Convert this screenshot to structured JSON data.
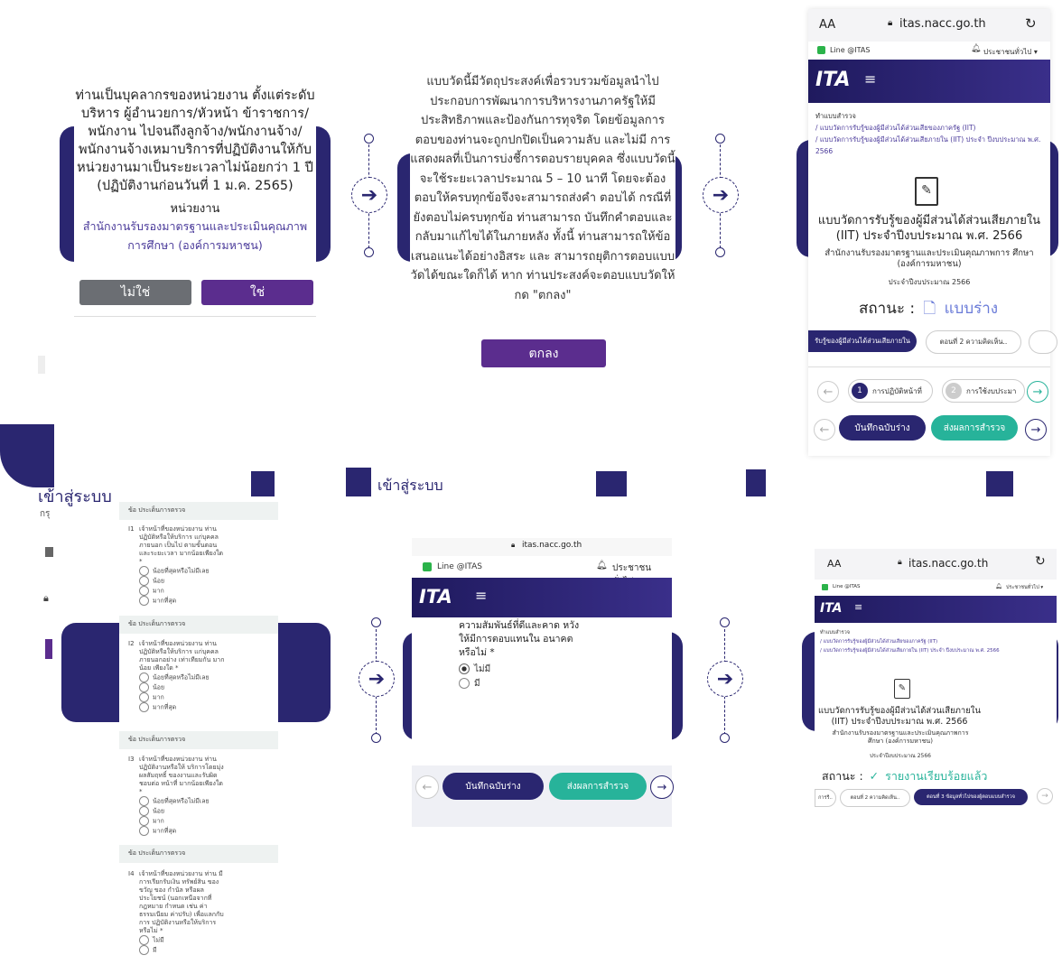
{
  "step1": {
    "question": "ท่านเป็นบุคลากรของหน่วยงาน ตั้งแต่ระดับ บริหาร ผู้อำนวยการ/หัวหน้า ข้าราชการ/ พนักงาน ไปจนถึงลูกจ้าง/พนักงานจ้าง/ พนักงานจ้างเหมาบริการที่ปฏิบัติงานให้กับ หน่วยงานมาเป็นระยะเวลาไม่น้อยกว่า 1 ปี (ปฏิบัติงานก่อนวันที่ 1 ม.ค. 2565)",
    "agency_label": "หน่วยงาน",
    "agency_name": "สำนักงานรับรองมาตรฐานและประเมินคุณภาพ การศึกษา (องค์การมหาชน)",
    "no_label": "ไม่ใช่",
    "yes_label": "ใช่"
  },
  "step2": {
    "text": "แบบวัดนี้มีวัตถุประสงค์เพื่อรวบรวมข้อมูลนำไป ประกอบการพัฒนาการบริหารงานภาครัฐให้มี ประสิทธิภาพและป้องกันการทุจริต โดยข้อมูลการ ตอบของท่านจะถูกปกปิดเป็นความลับ และไม่มี การแสดงผลที่เป็นการบ่งชี้การตอบรายบุคคล ซึ่งแบบวัดนี้จะใช้ระยะเวลาประมาณ 5 – 10 นาที โดยจะต้องตอบให้ครบทุกข้อจึงจะสามารถส่งคำ ตอบได้ กรณีที่ยังตอบไม่ครบทุกข้อ ท่านสามารถ บันทึกคำตอบและกลับมาแก้ไขได้ในภายหลัง ทั้งนี้ ท่านสามารถให้ข้อเสนอแนะได้อย่างอิสระ และ สามารถยุติการตอบแบบวัดได้ขณะใดก็ได้ หาก ท่านประสงค์จะตอบแบบวัดให้กด \"ตกลง\"",
    "ok_label": "ตกลง"
  },
  "step3": {
    "aa": "AA",
    "url": "itas.nacc.go.th",
    "line": "Line @ITAS",
    "public_menu": "ประชาชนทั่วไป ▾",
    "logo": "ITA",
    "breadcrumb": [
      "ทำแบบสำรวจ",
      "/ แบบวัดการรับรู้ของผู้มีส่วนได้ส่วนเสียของภาครัฐ (IIT)",
      "/ แบบวัดการรับรู้ของผู้มีส่วนได้ส่วนเสียภายใน (IIT) ประจำ ปีงบประมาณ พ.ศ. 2566"
    ],
    "title": "แบบวัดการรับรู้ของผู้มีส่วนได้ส่วนเสียภายใน (IIT) ประจำปีงบประมาณ พ.ศ. 2566",
    "org": "สำนักงานรับรองมาตรฐานและประเมินคุณภาพการ ศึกษา (องค์การมหาชน)",
    "fy": "ประจำปีงบประมาณ 2566",
    "status_label": "สถานะ :",
    "status_value": "แบบร่าง",
    "tab1": "รับรู้ของผู้มีส่วนได้ส่วนเสียภายใน",
    "tab2": "ตอนที่ 2 ความคิดเห็น..",
    "step_1": "การปฏิบัติหน้าที่",
    "step_2": "การใช้งบประมา",
    "save_draft": "บันทึกฉบับร่าง",
    "submit": "ส่งผลการสำรวจ"
  },
  "login": {
    "left": "เข้าสู่ระบบ",
    "mid": "เข้าสู่ระบบ",
    "hint": "กรุ"
  },
  "step4": {
    "sections": [
      {
        "header": "ข้อ ประเด็นการตรวจ",
        "num": "I1",
        "q": "เจ้าหน้าที่ของหน่วยงาน ท่าน ปฏิบัติหรือให้บริการ แก่บุคคลภายนอก เป็นไป ตามขั้นตอนและระยะเวลา มากน้อยเพียงใด *",
        "opts": [
          "น้อยที่สุดหรือไม่มีเลย",
          "น้อย",
          "มาก",
          "มากที่สุด"
        ]
      },
      {
        "header": "ข้อ ประเด็นการตรวจ",
        "num": "I2",
        "q": "เจ้าหน้าที่ของหน่วยงาน ท่าน ปฏิบัติหรือให้บริการ แก่บุคคลภายนอกอย่าง เท่าเทียมกัน มากน้อย เพียงใด *",
        "opts": [
          "น้อยที่สุดหรือไม่มีเลย",
          "น้อย",
          "มาก",
          "มากที่สุด"
        ]
      },
      {
        "header": "ข้อ ประเด็นการตรวจ",
        "num": "I3",
        "q": "เจ้าหน้าที่ของหน่วยงาน ท่าน ปฏิบัติงานหรือให้ บริการโดยมุ่งผลสัมฤทธิ์ ของงานและรับผิดชอบต่อ หน้าที่ มากน้อยเพียงใด *",
        "opts": [
          "น้อยที่สุดหรือไม่มีเลย",
          "น้อย",
          "มาก",
          "มากที่สุด"
        ]
      },
      {
        "header": "ข้อ ประเด็นการตรวจ",
        "num": "I4",
        "q": "เจ้าหน้าที่ของหน่วยงาน ท่าน มีการเรียกรับเงิน ทรัพย์สิน ของขวัญ ของ กำนัล หรือผลประโยชน์ (นอกเหนือจากที่กฎหมาย กำหนด เช่น ค่าธรรมเนียม ค่าปรับ) เพื่อแลกกับการ ปฏิบัติงานหรือให้บริการ หรือไม่ *",
        "opts": [
          "ไม่มี",
          "มี"
        ]
      }
    ]
  },
  "step5": {
    "url": "itas.nacc.go.th",
    "line": "Line @ITAS",
    "public_menu": "ประชาชนทั่วไป ▾",
    "logo": "ITA",
    "q_text": "ความสัมพันธ์ที่ดีและคาด หวังให้มีการตอบแทนใน อนาคต หรือไม่ *",
    "opt_none": "ไม่มี",
    "opt_yes": "มี",
    "save_draft": "บันทึกฉบับร่าง",
    "submit": "ส่งผลการสำรวจ"
  },
  "step6": {
    "aa": "AA",
    "url": "itas.nacc.go.th",
    "line": "Line @ITAS",
    "public_menu": "ประชาชนทั่วไป ▾",
    "logo": "ITA",
    "breadcrumb": [
      "ทำแบบสำรวจ",
      "/ แบบวัดการรับรู้ของผู้มีส่วนได้ส่วนเสียของภาครัฐ (IIT)",
      "/ แบบวัดการรับรู้ของผู้มีส่วนได้ส่วนเสียภายใน (IIT) ประจำ ปีงบประมาณ พ.ศ. 2566"
    ],
    "title": "แบบวัดการรับรู้ของผู้มีส่วนได้ส่วนเสียภายใน (IIT) ประจำปีงบประมาณ พ.ศ. 2566",
    "org": "สำนักงานรับรองมาตรฐานและประเมินคุณภาพการ ศึกษา (องค์การมหาชน)",
    "fy": "ประจำปีงบประมาณ 2566",
    "status_label": "สถานะ :",
    "status_value": "รายงานเรียบร้อยแล้ว",
    "tab_prev": "การรี..",
    "tab2": "ตอนที่ 2 ความคิดเห็น..",
    "tab3": "ตอนที่ 3 ข้อมูลทั่วไปของผู้ตอบแบบสำรวจ"
  },
  "colors": {
    "navy": "#2a2670",
    "purple": "#5b2d8e",
    "teal": "#27b39a",
    "gray": "#6b6e73",
    "agency": "#4a3a9a"
  }
}
